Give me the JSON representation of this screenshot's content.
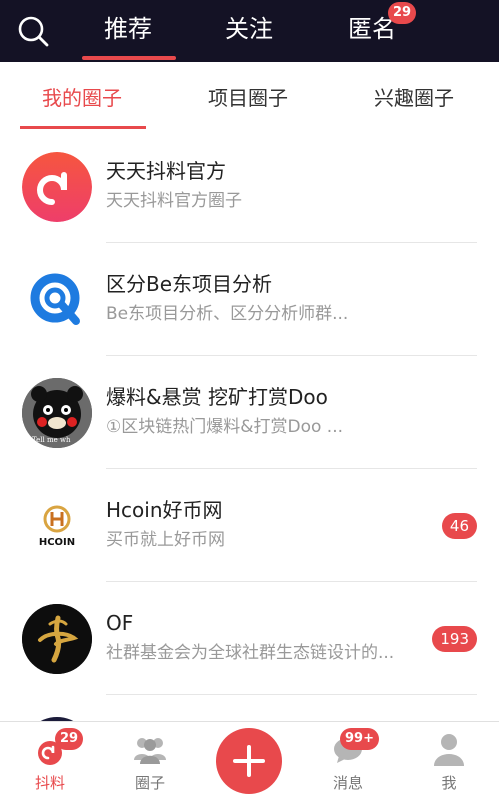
{
  "top_tabs": [
    {
      "label": "推荐"
    },
    {
      "label": "关注"
    },
    {
      "label": "匿名",
      "badge": "29"
    }
  ],
  "sub_tabs": [
    {
      "label": "我的圈子"
    },
    {
      "label": "项目圈子"
    },
    {
      "label": "兴趣圈子"
    }
  ],
  "circles": [
    {
      "title": "天天抖料官方",
      "subtitle": "天天抖料官方圈子",
      "count": ""
    },
    {
      "title": "区分Be东项目分析",
      "subtitle": "Be东项目分析、区分分析师群...",
      "count": ""
    },
    {
      "title": "爆料&悬赏 挖矿打赏Doo",
      "subtitle": "①区块链热门爆料&打赏Doo ...",
      "count": "",
      "avatar_text": "Tell me wh"
    },
    {
      "title": "Hcoin好币网",
      "subtitle": "买币就上好币网",
      "count": "46",
      "avatar_text": "HCOIN"
    },
    {
      "title": "OF",
      "subtitle": "社群基金会为全球社群生态链设计的...",
      "count": "193"
    }
  ],
  "bottom_nav": [
    {
      "label": "抖料",
      "badge": "29"
    },
    {
      "label": "圈子"
    },
    {
      "label": ""
    },
    {
      "label": "消息",
      "badge": "99+"
    },
    {
      "label": "我"
    }
  ],
  "colors": {
    "accent": "#e8494c",
    "topbar": "#141225"
  }
}
